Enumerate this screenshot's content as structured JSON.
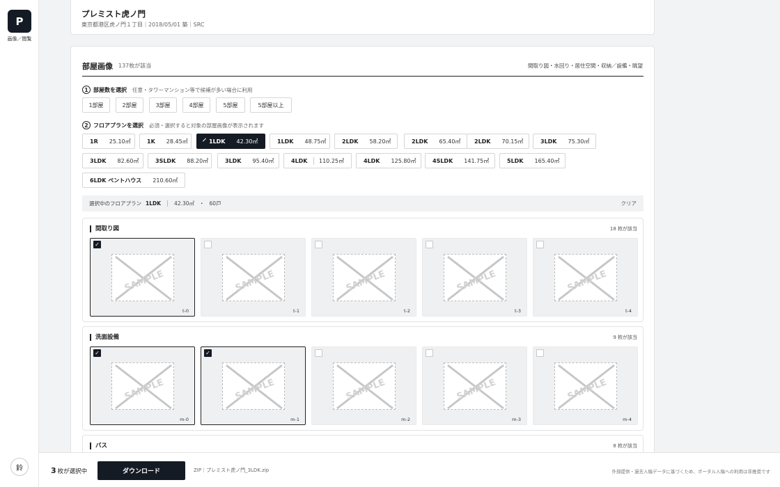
{
  "nav": {
    "logo": "P",
    "label": "画像／閲覧",
    "user_initial": "鈴"
  },
  "property": {
    "title": "プレミスト虎ノ門",
    "meta": "東京都港区虎ノ門１丁目｜2018/05/01 築｜SRC"
  },
  "section": {
    "title": "部屋画像",
    "count": "137枚が該当",
    "categories": "間取り図・水回り・居住空間・収納／設備・眺望"
  },
  "step1": {
    "num": "1",
    "label": "部屋数を選択",
    "hint": "任意・タワーマンション等で候補が多い場合に利用",
    "options": [
      "1部屋",
      "2部屋",
      "3部屋",
      "4部屋",
      "5部屋",
      "5部屋以上"
    ]
  },
  "step2": {
    "num": "2",
    "label": "フロアプランを選択",
    "hint": "必須・選択すると対象の部屋画像が表示されます",
    "plans": [
      {
        "type": "1R",
        "area": "25.10㎡"
      },
      {
        "type": "1K",
        "area": "28.45㎡"
      },
      {
        "type": "1LDK",
        "area": "42.30㎡",
        "selected": true
      },
      {
        "type": "1LDK",
        "area": "48.75㎡"
      },
      {
        "type": "2LDK",
        "area": "58.20㎡"
      },
      {
        "type": "2LDK",
        "area": "65.40㎡"
      },
      {
        "type": "2LDK",
        "area": "70.15㎡"
      },
      {
        "type": "3LDK",
        "area": "75.30㎡"
      },
      {
        "type": "3LDK",
        "area": "82.60㎡"
      },
      {
        "type": "3SLDK",
        "area": "88.20㎡"
      },
      {
        "type": "3LDK",
        "area": "95.40㎡"
      },
      {
        "type": "4LDK",
        "area": "110.25㎡"
      },
      {
        "type": "4LDK",
        "area": "125.80㎡"
      },
      {
        "type": "4SLDK",
        "area": "141.75㎡"
      },
      {
        "type": "5LDK",
        "area": "165.40㎡"
      },
      {
        "type": "6LDK ペントハウス",
        "area": "210.60㎡"
      }
    ]
  },
  "selection": {
    "label": "選択中のフロアプラン",
    "type": "1LDK",
    "area": "42.30㎡",
    "units": "60戸",
    "clear": "クリア"
  },
  "groups": [
    {
      "title": "間取り図",
      "count": "18 枚が該当",
      "items": [
        {
          "code": "t-0",
          "checked": true
        },
        {
          "code": "t-1",
          "checked": false
        },
        {
          "code": "t-2",
          "checked": false
        },
        {
          "code": "t-3",
          "checked": false
        },
        {
          "code": "t-4",
          "checked": false
        }
      ]
    },
    {
      "title": "洗面設備",
      "count": "9 枚が該当",
      "items": [
        {
          "code": "m-0",
          "checked": true
        },
        {
          "code": "m-1",
          "checked": true
        },
        {
          "code": "m-2",
          "checked": false
        },
        {
          "code": "m-3",
          "checked": false
        },
        {
          "code": "m-4",
          "checked": false
        }
      ]
    },
    {
      "title": "バス",
      "count": "8 枚が該当",
      "items": []
    }
  ],
  "sample_text": "SAMPLE",
  "checkmark": "✓",
  "footer": {
    "count": "3",
    "count_suffix": "枚が選択中",
    "download": "ダウンロード",
    "zip": "ZIP｜プレミスト虎ノ門_3LDK.zip",
    "note": "外部提供・過去入稿データに基づくため、ポータル入稿への利用は非推奨です"
  }
}
